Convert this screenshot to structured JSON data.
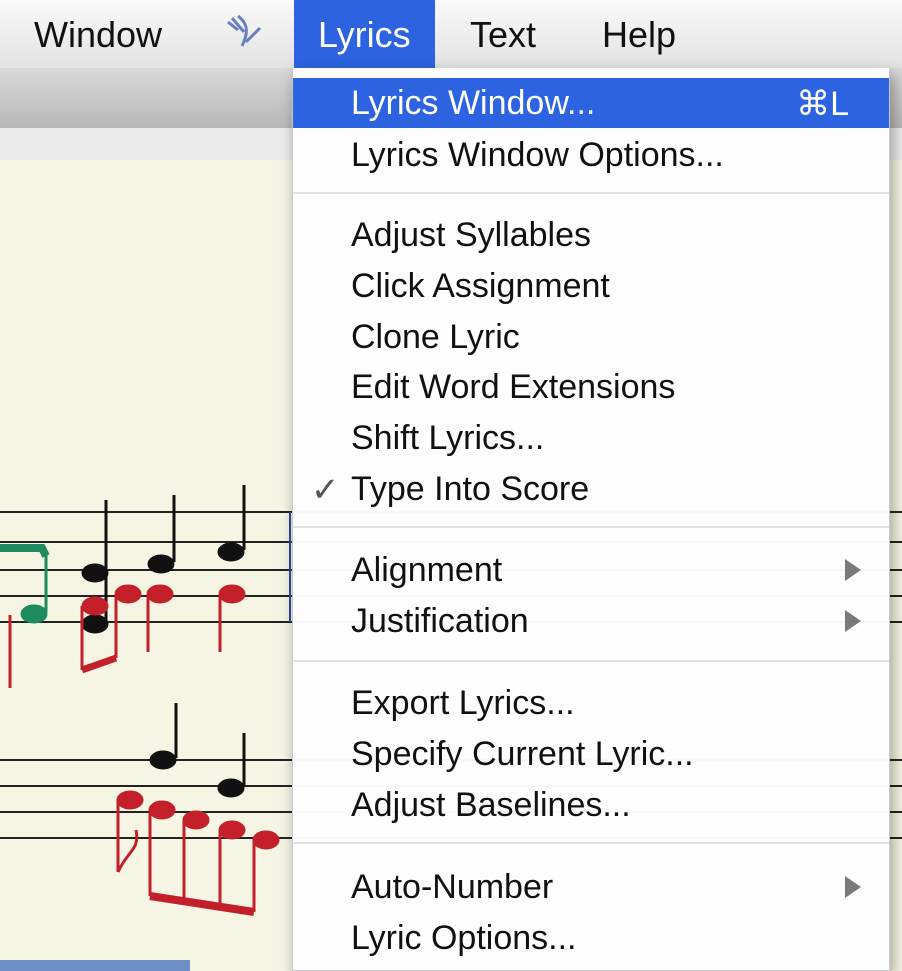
{
  "menubar": {
    "items": [
      {
        "label": "Window"
      },
      {
        "label": "Lyrics"
      },
      {
        "label": "Text"
      },
      {
        "label": "Help"
      }
    ],
    "icon": "script-glyph-icon"
  },
  "menu": {
    "groups": [
      [
        {
          "label": "Lyrics Window...",
          "shortcut": "⌘L",
          "selected": true
        },
        {
          "label": "Lyrics Window Options..."
        }
      ],
      [
        {
          "label": "Adjust Syllables"
        },
        {
          "label": "Click Assignment"
        },
        {
          "label": "Clone Lyric"
        },
        {
          "label": "Edit Word Extensions"
        },
        {
          "label": "Shift Lyrics..."
        },
        {
          "label": "Type Into Score",
          "checked": true,
          "check": "✓"
        }
      ],
      [
        {
          "label": "Alignment",
          "submenu": true
        },
        {
          "label": "Justification",
          "submenu": true
        }
      ],
      [
        {
          "label": "Export Lyrics..."
        },
        {
          "label": "Specify Current Lyric..."
        },
        {
          "label": "Adjust Baselines..."
        }
      ],
      [
        {
          "label": "Auto-Number",
          "submenu": true
        },
        {
          "label": "Lyric Options..."
        }
      ]
    ]
  },
  "colors": {
    "highlight": "#2d63e0",
    "note_black": "#111111",
    "note_red": "#c3202c",
    "note_green": "#1f8a5e",
    "paper": "#f6f5e4"
  }
}
